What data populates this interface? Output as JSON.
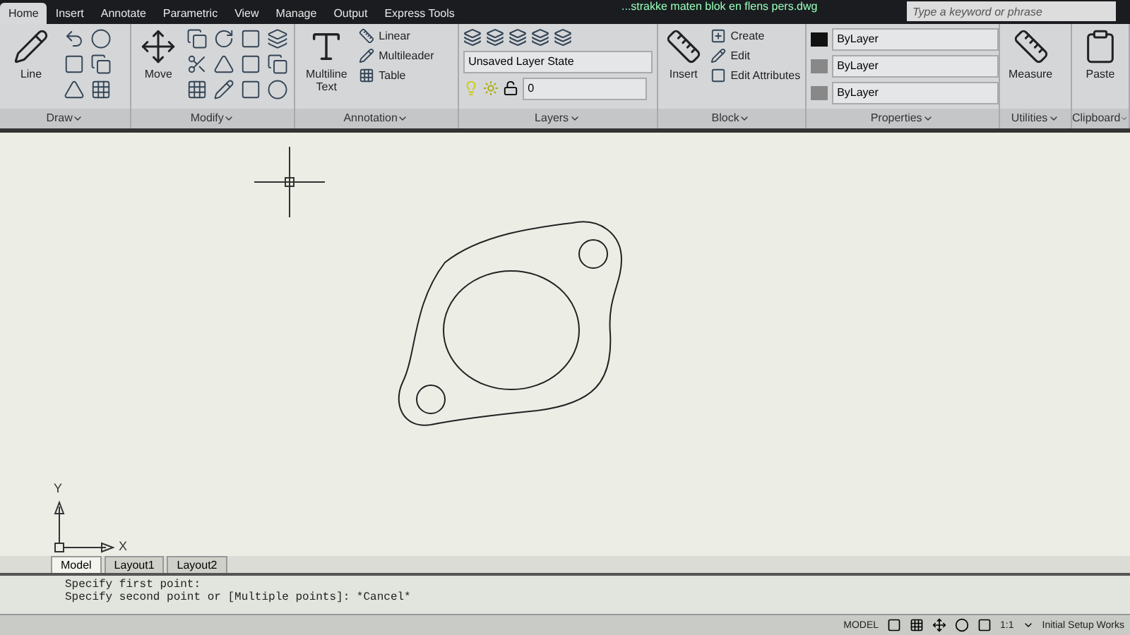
{
  "title_bar": {
    "title": "...strakke maten blok en flens pers.dwg",
    "search": {
      "placeholder": "Type a keyword or phrase"
    }
  },
  "tabs": [
    {
      "label": "Home",
      "selected": true
    },
    {
      "label": "Insert",
      "selected": false
    },
    {
      "label": "Annotate",
      "selected": false
    },
    {
      "label": "Parametric",
      "selected": false
    },
    {
      "label": "View",
      "selected": false
    },
    {
      "label": "Manage",
      "selected": false
    },
    {
      "label": "Output",
      "selected": false
    },
    {
      "label": "Express Tools",
      "selected": false
    }
  ],
  "panels": [
    {
      "title": "Draw",
      "items": [
        {
          "kind": "large",
          "label": "Line"
        },
        {
          "kind": "grid"
        }
      ]
    },
    {
      "title": "Modify",
      "items": [
        {
          "kind": "large",
          "label": "Move"
        },
        {
          "kind": "grid"
        }
      ]
    },
    {
      "title": "Annotation",
      "items": [
        {
          "kind": "large",
          "label": "Multiline Text"
        },
        {
          "kind": "list",
          "entries": [
            "Linear",
            "Multileader",
            "Table"
          ]
        }
      ]
    },
    {
      "title": "Layers",
      "items": [
        {
          "kind": "dropdowns",
          "entries": [
            "Unsaved Layer State",
            "0"
          ]
        }
      ]
    },
    {
      "title": "Block",
      "items": [
        {
          "kind": "large",
          "label": "Insert"
        },
        {
          "kind": "list",
          "entries": [
            "Create",
            "Edit",
            "Edit Attributes"
          ]
        }
      ]
    },
    {
      "title": "Properties",
      "items": [
        {
          "kind": "dropdowns",
          "entries": [
            "ByLayer",
            "ByLayer",
            "ByLayer"
          ]
        }
      ]
    },
    {
      "title": "Utilities",
      "items": [
        {
          "kind": "large",
          "label": "Measure"
        }
      ]
    },
    {
      "title": "Clipboard",
      "items": [
        {
          "kind": "large",
          "label": "Paste"
        }
      ]
    }
  ],
  "canvas": {
    "axis_x": "X",
    "axis_y": "Y"
  },
  "layout_tabs": [
    {
      "label": "Model",
      "selected": true
    },
    {
      "label": "Layout1",
      "selected": false
    },
    {
      "label": "Layout2",
      "selected": false
    }
  ],
  "command_lines": [
    "Specify first point:",
    "Specify second point or [Multiple points]: *Cancel*"
  ],
  "status_bar": {
    "mode": "MODEL",
    "scale": "1:1",
    "workspace": "Initial Setup Works"
  }
}
